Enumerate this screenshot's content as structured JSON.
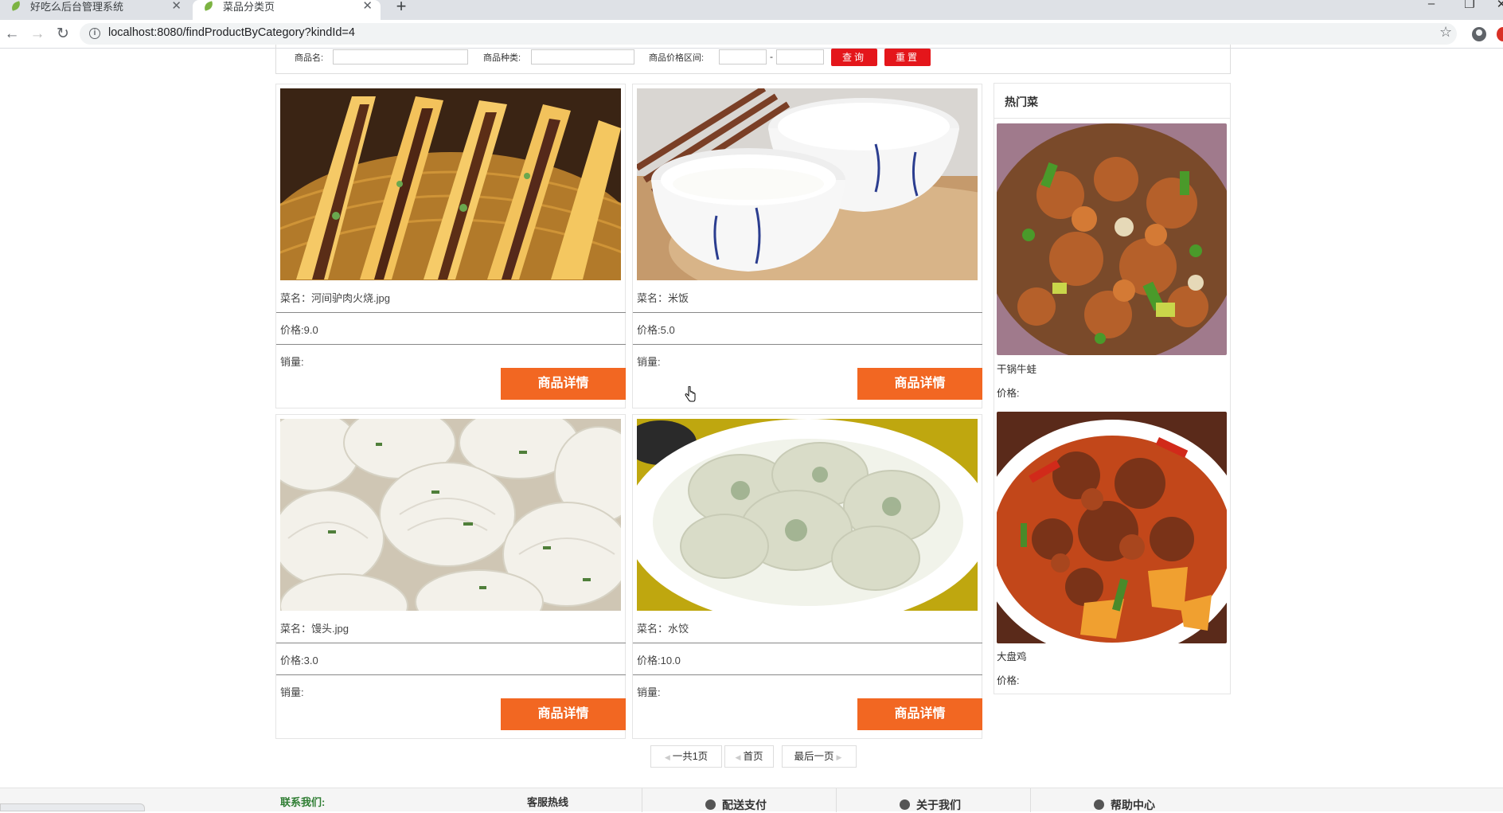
{
  "browser": {
    "tabs": [
      {
        "title": "好吃么后台管理系统",
        "active": false
      },
      {
        "title": "菜品分类页",
        "active": true
      }
    ],
    "url": "localhost:8080/findProductByCategory?kindId=4"
  },
  "search": {
    "name_label": "商品名:",
    "kind_label": "商品种类:",
    "price_label": "商品价格区间:",
    "range_sep": "-",
    "query_button": "查询",
    "reset_button": "重置"
  },
  "products": [
    {
      "name_line": "菜名：河间驴肉火烧.jpg",
      "price_line": "价格:9.0",
      "sales_line": "销量:",
      "button": "商品详情",
      "image": "donkey-meat-burger"
    },
    {
      "name_line": "菜名：米饭",
      "price_line": "价格:5.0",
      "sales_line": "销量:",
      "button": "商品详情",
      "image": "rice-bowls"
    },
    {
      "name_line": "菜名：馒头.jpg",
      "price_line": "价格:3.0",
      "sales_line": "销量:",
      "button": "商品详情",
      "image": "scallion-buns"
    },
    {
      "name_line": "菜名：水饺",
      "price_line": "价格:10.0",
      "sales_line": "销量:",
      "button": "商品详情",
      "image": "dumplings"
    }
  ],
  "hot": {
    "title": "热门菜",
    "items": [
      {
        "name": "干锅牛蛙",
        "price_label": "价格:",
        "image": "dry-pot-bullfrog"
      },
      {
        "name": "大盘鸡",
        "price_label": "价格:",
        "image": "big-plate-chicken"
      }
    ]
  },
  "pagination": {
    "total": "一共1页",
    "first": "首页",
    "last": "最后一页"
  },
  "footer": {
    "contact": "联系我们:",
    "hotline": "客服热线",
    "delivery": "配送支付",
    "about": "关于我们",
    "help": "帮助中心"
  },
  "colors": {
    "detail_button": "#f26722",
    "query_button": "#e4161b",
    "contact_text": "#2e7d32"
  }
}
